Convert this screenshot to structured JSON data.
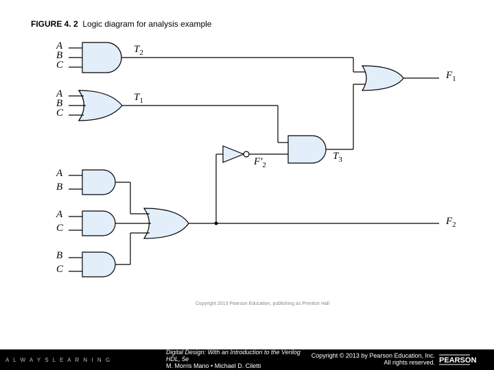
{
  "figure": {
    "number": "FIGURE 4. 2",
    "caption": "Logic diagram for analysis example"
  },
  "labels": {
    "T2": "T",
    "T2_sub": "2",
    "T1": "T",
    "T1_sub": "1",
    "T3": "T",
    "T3_sub": "3",
    "F1": "F",
    "F1_sub": "1",
    "F2": "F",
    "F2_sub": "2",
    "F2p": "F'",
    "F2p_sub": "2",
    "g1_in1": "A",
    "g1_in2": "B",
    "g1_in3": "C",
    "g2_in1": "A",
    "g2_in2": "B",
    "g2_in3": "C",
    "g3_in1": "A",
    "g3_in2": "B",
    "g4_in1": "A",
    "g4_in2": "C",
    "g5_in1": "B",
    "g5_in2": "C"
  },
  "watermark": "Copyright 2013 Pearson Education, publishing as Prentice Hall",
  "footer": {
    "always": "A L W A Y S   L E A R N I N G",
    "book_title": "Digital Design: With an Introduction to the Verilog HDL",
    "book_edition": ", 5e",
    "authors": "M. Morris Mano • Michael D. Ciletti",
    "copyright_line1": "Copyright © 2013 by Pearson Education, Inc.",
    "copyright_line2": "All rights reserved.",
    "logo_text": "PEARSON"
  },
  "diagram": {
    "gates": [
      {
        "id": "g1",
        "type": "AND3",
        "inputs": [
          "A",
          "B",
          "C"
        ],
        "output": "T2"
      },
      {
        "id": "g2",
        "type": "OR3",
        "inputs": [
          "A",
          "B",
          "C"
        ],
        "output": "T1"
      },
      {
        "id": "g3",
        "type": "AND2",
        "inputs": [
          "A",
          "B"
        ],
        "output": "n3"
      },
      {
        "id": "g4",
        "type": "AND2",
        "inputs": [
          "A",
          "C"
        ],
        "output": "n4"
      },
      {
        "id": "g5",
        "type": "AND2",
        "inputs": [
          "B",
          "C"
        ],
        "output": "n5"
      },
      {
        "id": "g6",
        "type": "OR3",
        "inputs": [
          "n3",
          "n4",
          "n5"
        ],
        "output": "F2"
      },
      {
        "id": "inv",
        "type": "NOT",
        "inputs": [
          "F2"
        ],
        "output": "F2p"
      },
      {
        "id": "g7",
        "type": "AND2",
        "inputs": [
          "T1",
          "F2p"
        ],
        "output": "T3"
      },
      {
        "id": "g8",
        "type": "OR2",
        "inputs": [
          "T2",
          "T3"
        ],
        "output": "F1"
      }
    ],
    "outputs": [
      "F1",
      "F2"
    ]
  }
}
